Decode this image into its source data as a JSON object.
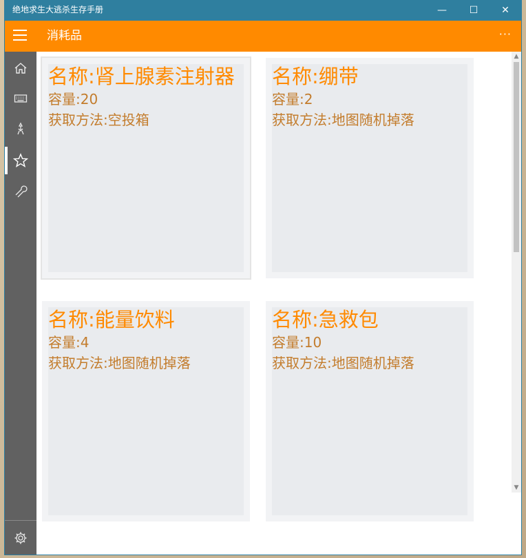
{
  "window": {
    "title": "绝地求生大逃杀生存手册",
    "minimize_glyph": "—",
    "maximize_glyph": "☐",
    "close_glyph": "✕"
  },
  "appbar": {
    "title": "消耗品",
    "more_glyph": "···"
  },
  "sidebar": {
    "items": [
      {
        "icon": "home-icon"
      },
      {
        "icon": "keyboard-icon"
      },
      {
        "icon": "weapon-icon"
      },
      {
        "icon": "star-icon",
        "active": true
      },
      {
        "icon": "wrench-icon"
      }
    ],
    "settings_icon": "gear-icon"
  },
  "items": [
    {
      "name": "名称:肾上腺素注射器",
      "capacity": "容量:20",
      "source": "获取方法:空投箱"
    },
    {
      "name": "名称:绷带",
      "capacity": "容量:2",
      "source": "获取方法:地图随机掉落"
    },
    {
      "name": "名称:能量饮料",
      "capacity": "容量:4",
      "source": "获取方法:地图随机掉落"
    },
    {
      "name": "名称:急救包",
      "capacity": "容量:10",
      "source": "获取方法:地图随机掉落"
    }
  ],
  "colors": {
    "titlebar": "#2f7f9f",
    "accent": "#ff8a00",
    "sidebar": "#616161",
    "item_text": "#c37c2c"
  }
}
